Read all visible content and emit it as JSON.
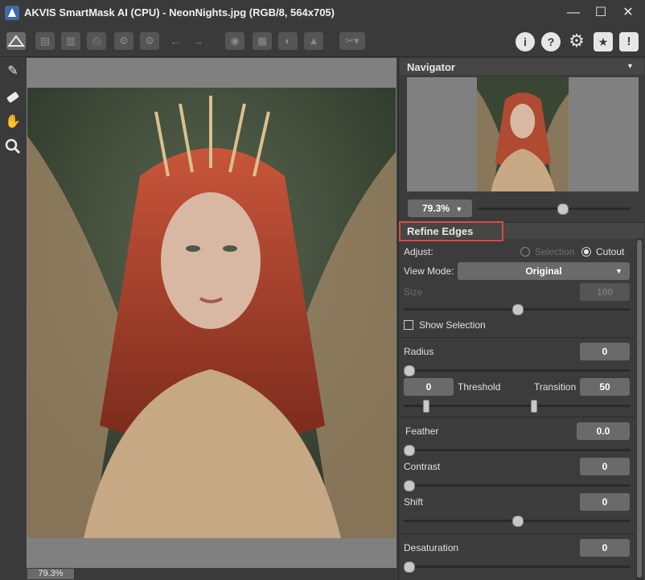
{
  "window": {
    "title": "AKVIS SmartMask AI (CPU) - NeonNights.jpg (RGB/8, 564x705)",
    "minimize_glyph": "—",
    "maximize_glyph": "☐",
    "close_glyph": "✕"
  },
  "toolbar": {
    "left_icons": [
      "app-home-icon",
      "open-file-icon",
      "save-file-icon",
      "print-icon",
      "preset-load-icon",
      "preset-save-icon",
      "undo-icon",
      "redo-icon",
      "run-icon",
      "channels-icon",
      "background-icon",
      "image-icon",
      "crop-tool-icon"
    ],
    "right_icons": {
      "info": "i",
      "help": "?",
      "settings": "⚙",
      "ratings": "★",
      "feedback": "!"
    }
  },
  "left_tools": [
    "magic-brush-icon",
    "eraser-icon",
    "hand-icon",
    "zoom-icon"
  ],
  "status": {
    "zoom": "79.3%"
  },
  "navigator": {
    "title": "Navigator",
    "collapse_glyph": "▼",
    "zoom_value": "79.3%",
    "zoom_level": 0.55
  },
  "refine": {
    "title": "Refine Edges",
    "adjust_label": "Adjust:",
    "opt_selection": "Selection",
    "opt_cutout": "Cutout",
    "view_mode_label": "View Mode:",
    "view_mode_value": "Original",
    "size_label": "Size",
    "size_value": "100",
    "size_level": 0.5,
    "show_selection_label": "Show Selection",
    "radius_label": "Radius",
    "radius_value": "0",
    "threshold_value": "0",
    "threshold_label": "Threshold",
    "transition_label": "Transition",
    "transition_value": "50",
    "feather_label": "Feather",
    "feather_value": "0.0",
    "contrast_label": "Contrast",
    "contrast_value": "0",
    "shift_label": "Shift",
    "shift_value": "0",
    "shift_level": 0.5,
    "desaturation_label": "Desaturation",
    "desaturation_value": "0"
  },
  "colors": {
    "highlight_box": "#e04848",
    "panel_bg": "#3c3c3c",
    "canvas_bg": "#808080"
  }
}
